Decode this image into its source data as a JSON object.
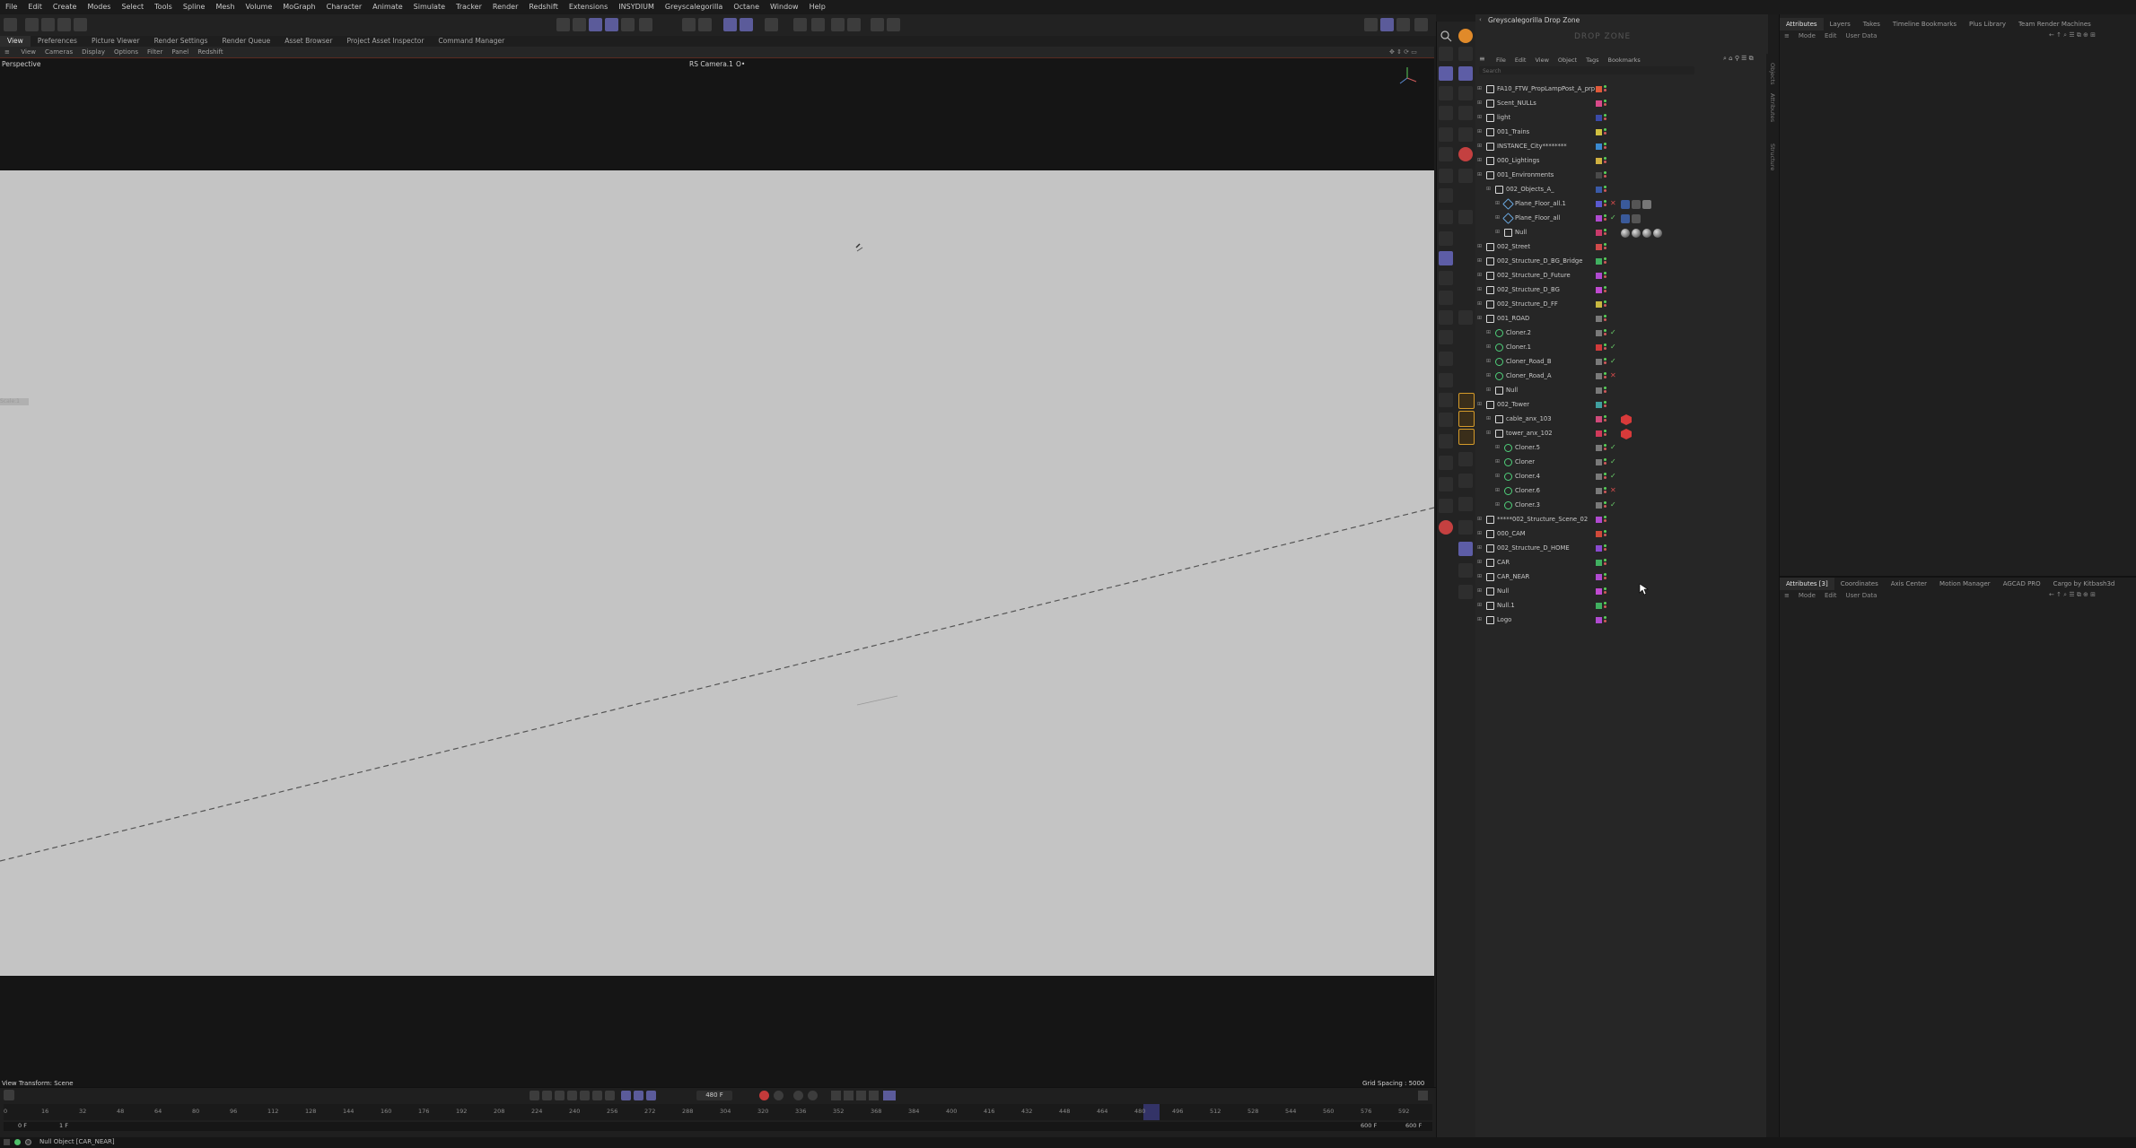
{
  "menubar": {
    "items": [
      "File",
      "Edit",
      "Create",
      "Modes",
      "Select",
      "Tools",
      "Spline",
      "Mesh",
      "Volume",
      "MoGraph",
      "Character",
      "Animate",
      "Simulate",
      "Tracker",
      "Render",
      "Redshift",
      "Extensions",
      "INSYDIUM",
      "Greyscalegorilla",
      "Octane",
      "Window",
      "Help"
    ]
  },
  "layout_tabs": {
    "items": [
      "View",
      "Preferences",
      "Picture Viewer",
      "Render Settings",
      "Render Queue",
      "Asset Browser",
      "Project Asset Inspector",
      "Command Manager"
    ],
    "active": "View"
  },
  "viewport": {
    "menu": [
      "View",
      "Cameras",
      "Display",
      "Options",
      "Filter",
      "Panel",
      "Redshift"
    ],
    "projection": "Perspective",
    "camera": "RS Camera.1",
    "camera_suffix": "O•",
    "status_left": "View Transform: Scene",
    "status_right": "Grid Spacing : 5000 cm",
    "hud_label": "Scale:1"
  },
  "timeline": {
    "current_frame": "480 F",
    "start_frame": "0 F",
    "start_frame_2": "1 F",
    "end_frame": "600 F",
    "end_frame_2": "600 F",
    "ruler": [
      "0",
      "16",
      "32",
      "48",
      "64",
      "80",
      "96",
      "112",
      "128",
      "144",
      "160",
      "176",
      "192",
      "208",
      "224",
      "240",
      "256",
      "272",
      "288",
      "304",
      "320",
      "336",
      "352",
      "368",
      "384",
      "400",
      "416",
      "432",
      "448",
      "464",
      "480",
      "496",
      "512",
      "528",
      "544",
      "560",
      "576",
      "592"
    ]
  },
  "status_bar": {
    "text": "Null Object [CAR_NEAR]"
  },
  "object_manager": {
    "dropzone_title": "Greyscalegorilla Drop Zone",
    "dropzone_watermark": "DROP ZONE",
    "menu": [
      "File",
      "Edit",
      "View",
      "Object",
      "Tags",
      "Bookmarks"
    ],
    "search_placeholder": "Search",
    "objects": [
      {
        "name": "FA10_FTW_PropLampPost_A_prp",
        "depth": 0,
        "color": "#e05a3a",
        "kind": "null"
      },
      {
        "name": "Scent_NULLs",
        "depth": 0,
        "color": "#d84a8a",
        "kind": "null"
      },
      {
        "name": "light",
        "depth": 0,
        "color": "#3a4aa8",
        "kind": "null"
      },
      {
        "name": "001_Trains",
        "depth": 0,
        "color": "#d0c040",
        "kind": "null"
      },
      {
        "name": "INSTANCE_City********",
        "depth": 0,
        "color": "#3a8ad0",
        "kind": "null"
      },
      {
        "name": "000_Lightings",
        "depth": 0,
        "color": "#d0b040",
        "kind": "null"
      },
      {
        "name": "001_Environments",
        "depth": 0,
        "color": "#4a4a4a",
        "kind": "null"
      },
      {
        "name": "002_Objects_A_",
        "depth": 1,
        "color": "#3a5aa8",
        "kind": "null"
      },
      {
        "name": "Plane_Floor_all.1",
        "depth": 2,
        "color": "#5a5ad0",
        "kind": "plane"
      },
      {
        "name": "Plane_Floor_all",
        "depth": 2,
        "color": "#b04ad0",
        "kind": "plane"
      },
      {
        "name": "Null",
        "depth": 2,
        "color": "#c83a6a",
        "kind": "null"
      },
      {
        "name": "002_Street",
        "depth": 0,
        "color": "#d04a4a",
        "kind": "null"
      },
      {
        "name": "002_Structure_D_BG_Bridge",
        "depth": 0,
        "color": "#40b060",
        "kind": "null"
      },
      {
        "name": "002_Structure_D_Future",
        "depth": 0,
        "color": "#b04ad0",
        "kind": "null"
      },
      {
        "name": "002_Structure_D_BG",
        "depth": 0,
        "color": "#c04ad0",
        "kind": "null"
      },
      {
        "name": "002_Structure_D_FF",
        "depth": 0,
        "color": "#c8b840",
        "kind": "null"
      },
      {
        "name": "001_ROAD",
        "depth": 0,
        "color": "#7a7a7a",
        "kind": "null"
      },
      {
        "name": "Cloner.2",
        "depth": 1,
        "color": "#7a7a7a",
        "kind": "cloner"
      },
      {
        "name": "Cloner.1",
        "depth": 1,
        "color": "#d03a3a",
        "kind": "cloner"
      },
      {
        "name": "Cloner_Road_B",
        "depth": 1,
        "color": "#7a7a7a",
        "kind": "cloner"
      },
      {
        "name": "Cloner_Road_A",
        "depth": 1,
        "color": "#7a7a7a",
        "kind": "cloner"
      },
      {
        "name": "Null",
        "depth": 1,
        "color": "#7a7a7a",
        "kind": "null"
      },
      {
        "name": "002_Tower",
        "depth": 0,
        "color": "#40a0a0",
        "kind": "null"
      },
      {
        "name": "cable_anx_103",
        "depth": 1,
        "color": "#d04a7a",
        "kind": "null"
      },
      {
        "name": "tower_anx_102",
        "depth": 1,
        "color": "#d03a5a",
        "kind": "null"
      },
      {
        "name": "Cloner.5",
        "depth": 2,
        "color": "#7a7a7a",
        "kind": "cloner"
      },
      {
        "name": "Cloner",
        "depth": 2,
        "color": "#7a7a7a",
        "kind": "cloner"
      },
      {
        "name": "Cloner.4",
        "depth": 2,
        "color": "#7a7a7a",
        "kind": "cloner"
      },
      {
        "name": "Cloner.6",
        "depth": 2,
        "color": "#7a7a7a",
        "kind": "cloner"
      },
      {
        "name": "Cloner.3",
        "depth": 2,
        "color": "#7a7a7a",
        "kind": "cloner"
      },
      {
        "name": "*****002_Structure_Scene_02",
        "depth": 0,
        "color": "#b04ad0",
        "kind": "null"
      },
      {
        "name": "000_CAM",
        "depth": 0,
        "color": "#d04a3a",
        "kind": "null"
      },
      {
        "name": "002_Structure_D_HOME",
        "depth": 0,
        "color": "#8a4ad0",
        "kind": "null"
      },
      {
        "name": "CAR",
        "depth": 0,
        "color": "#40b060",
        "kind": "null"
      },
      {
        "name": "CAR_NEAR",
        "depth": 0,
        "color": "#b04ad0",
        "kind": "null"
      },
      {
        "name": "Null",
        "depth": 0,
        "color": "#c04ad0",
        "kind": "null"
      },
      {
        "name": "Null.1",
        "depth": 0,
        "color": "#40b060",
        "kind": "null"
      },
      {
        "name": "Logo",
        "depth": 0,
        "color": "#b04ad0",
        "kind": "null"
      }
    ]
  },
  "attributes_top": {
    "tabs": [
      "Attributes",
      "Layers",
      "Takes",
      "Timeline Bookmarks",
      "Plus Library",
      "Team Render Machines"
    ],
    "active": "Attributes",
    "sub": [
      "Mode",
      "Edit",
      "User Data"
    ]
  },
  "attributes_bottom": {
    "tabs": [
      "Attributes [3]",
      "Coordinates",
      "Axis Center",
      "Motion Manager",
      "AGCAD PRO",
      "Cargo by Kitbash3d"
    ],
    "active": "Attributes [3]",
    "sub": [
      "Mode",
      "Edit",
      "User Data"
    ]
  },
  "side_tabs": [
    "Objects",
    "Attributes",
    "Structure"
  ]
}
